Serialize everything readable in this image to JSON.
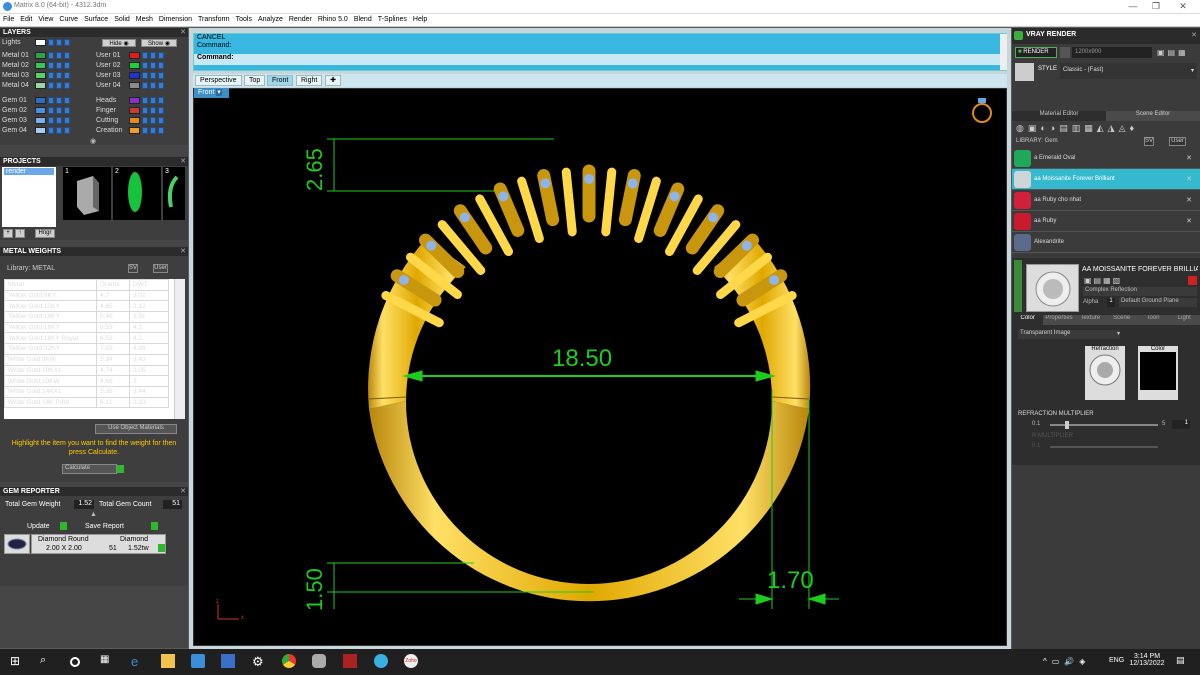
{
  "window": {
    "title": "Matrix 8.0 (64-bit) - 4312.3dm",
    "minimize": "—",
    "maximize": "❐",
    "close": "✕"
  },
  "menu": [
    "File",
    "Edit",
    "View",
    "Curve",
    "Surface",
    "Solid",
    "Mesh",
    "Dimension",
    "Transform",
    "Tools",
    "Analyze",
    "Render",
    "Rhino 5.0",
    "Blend",
    "T-Splines",
    "Help"
  ],
  "layers": {
    "title": "LAYERS",
    "lights_label": "Lights",
    "hide_label": "Hide",
    "show_label": "Show",
    "left_rows": [
      {
        "name": "Metal 01",
        "color": "#2fa24f"
      },
      {
        "name": "Metal 02",
        "color": "#3cc45a"
      },
      {
        "name": "Metal 03",
        "color": "#57d36e"
      },
      {
        "name": "Metal 04",
        "color": "#9ad8a3"
      },
      {
        "name": "Gem 01",
        "color": "#2c6fc6"
      },
      {
        "name": "Gem 02",
        "color": "#4b8fe0"
      },
      {
        "name": "Gem 03",
        "color": "#7bb2ec"
      },
      {
        "name": "Gem 04",
        "color": "#a7cbf4"
      }
    ],
    "right_rows": [
      {
        "name": "User 01",
        "color": "#e21c1c"
      },
      {
        "name": "User 02",
        "color": "#1fcf38"
      },
      {
        "name": "User 03",
        "color": "#1d32d8"
      },
      {
        "name": "User 04",
        "color": "#8b8b8b"
      },
      {
        "name": "Heads",
        "color": "#8a2fc7"
      },
      {
        "name": "Finger",
        "color": "#c83a3a"
      },
      {
        "name": "Cutting",
        "color": "#e88a1c"
      },
      {
        "name": "Creation",
        "color": "#f0a02a"
      }
    ]
  },
  "projects": {
    "title": "PROJECTS",
    "item": "render",
    "slots": [
      "1",
      "2",
      "3"
    ],
    "hinge_btn": "Hngr"
  },
  "metal_weights": {
    "title": "METAL WEIGHTS",
    "library": "Library: METAL",
    "sv": "SV",
    "user": "User",
    "columns": [
      "Metal",
      "Grams",
      "DWT"
    ],
    "rows": [
      [
        "Yellow Gold:9KY",
        "4.7",
        "3.02"
      ],
      [
        "Yellow Gold:10KY",
        "4.85",
        "3.12"
      ],
      [
        "Yellow Gold:14KY",
        "5.46",
        "3.51"
      ],
      [
        "Yellow Gold:18KY",
        "6.53",
        "4.2"
      ],
      [
        "Yellow Gold:18KY Royal",
        "6.53",
        "4.2"
      ],
      [
        "Yellow Gold:22KY",
        "7.59",
        "4.88"
      ],
      [
        "White Gold:9KW",
        "5.34",
        "3.43"
      ],
      [
        "White Gold:10KX1",
        "4.74",
        "3.05"
      ],
      [
        "White Gold:10KW",
        "4.66",
        "3"
      ],
      [
        "White Gold:14KX1",
        "5.35",
        "3.44"
      ],
      [
        "White Gold:14K PdW",
        "6.11",
        "3.93"
      ]
    ],
    "use_object_materials": "Use Object Materials",
    "hint": "Highlight the item you want to find the weight for then press Calculate.",
    "calculate": "Calculate"
  },
  "gem_reporter": {
    "title": "GEM REPORTER",
    "total_weight_label": "Total Gem Weight",
    "total_weight": "1.52",
    "total_count_label": "Total Gem Count",
    "total_count": "51",
    "update": "Update",
    "save_report": "Save Report",
    "gem": {
      "shape": "Diamond Round",
      "size": "2.00 X 2.00",
      "material": "Diamond",
      "count": "51",
      "weight": "1.52tw"
    }
  },
  "command": {
    "line1": "CANCEL",
    "line2": "Command:",
    "prompt": "Command:"
  },
  "view_tabs": [
    "Perspective",
    "Top",
    "Front",
    "Right"
  ],
  "active_view": "Front",
  "view_label": "Front",
  "dimensions": {
    "width": "18.50",
    "top_height": "2.65",
    "bottom_height": "1.50",
    "side_thickness": "1.70"
  },
  "axis": {
    "z": "z",
    "x": "x"
  },
  "vray": {
    "title": "VRAY RENDER",
    "render_btn": "RENDER",
    "resolution": "1200x900",
    "style_label": "STYLE",
    "style_value": "Classic - (Fast)",
    "tabs": [
      "Material Editor",
      "Scene Editor"
    ],
    "library": "LIBRARY: Gem",
    "sv": "SV",
    "user": "User",
    "materials": [
      {
        "name": "a Emerald Oval",
        "color": "#1fa85a",
        "selected": false
      },
      {
        "name": "aa Moissanite Forever Brilliant",
        "color": "#cfd6da",
        "selected": true
      },
      {
        "name": "aa Ruby cho nhat",
        "color": "#d0203a",
        "selected": false
      },
      {
        "name": "aa Ruby",
        "color": "#c81c2e",
        "selected": false
      },
      {
        "name": "Alexandrite",
        "color": "#5a6a8a",
        "selected": false
      }
    ],
    "selected_title": "AA MOISSANITE FOREVER BRILLIANT",
    "reflection": "Complex Reflection",
    "alpha_label": "Alpha",
    "alpha_value": "1",
    "ground": "Default Ground Plane",
    "sub_tabs": [
      "Color",
      "Properties",
      "Texture",
      "Scene",
      "Toon",
      "Light"
    ],
    "transparent": "Transparent Image",
    "refraction_label": "Refraction",
    "color_label": "Color",
    "refraction_multiplier_title": "REFRACTION MULTIPLIER",
    "rm_min": "0.1",
    "rm_max": "5",
    "rm_value": "1",
    "multiplier_title": "R MULTIPLIER",
    "m_min": "0.1"
  },
  "taskbar": {
    "lang": "ENG",
    "time": "3:14 PM",
    "date": "12/13/2022",
    "zoho": "Zoho"
  }
}
